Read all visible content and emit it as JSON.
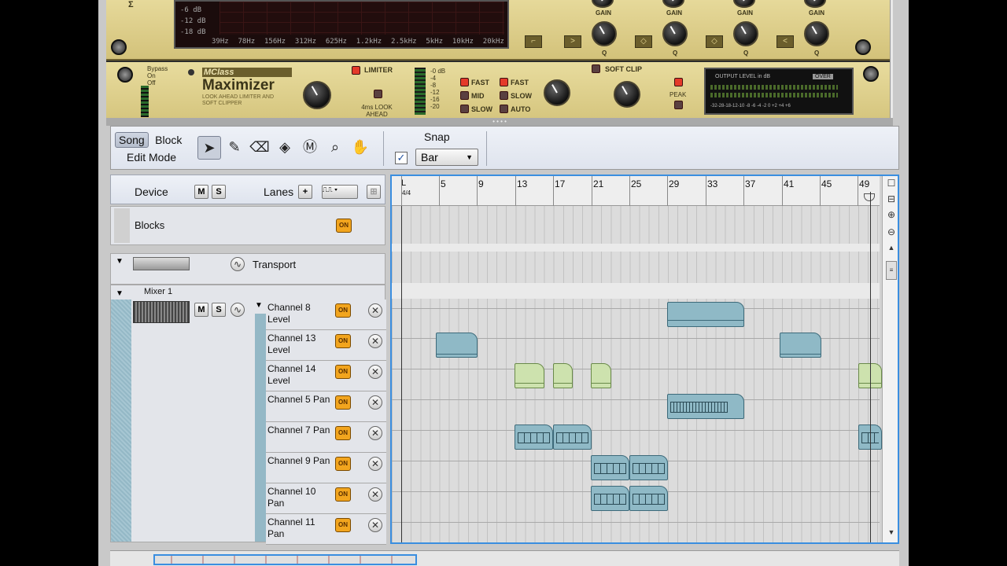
{
  "eq": {
    "db_labels": [
      "-6 dB",
      "-12 dB",
      "-18 dB"
    ],
    "freq_labels": [
      "39Hz",
      "78Hz",
      "156Hz",
      "312Hz",
      "625Hz",
      "1.2kHz",
      "2.5kHz",
      "5kHz",
      "10kHz",
      "20kHz"
    ],
    "gain_label": "GAIN",
    "q_label": "Q",
    "sigma": "Σ"
  },
  "maximizer": {
    "bypass": [
      "Bypass",
      "On",
      "Off"
    ],
    "brand": "MClass",
    "title": "Maximizer",
    "subtitle": "LOOK AHEAD LIMITER AND SOFT CLIPPER",
    "limiter_label": "LIMITER",
    "lookahead_label": "4ms LOOK AHEAD",
    "meter_scale": [
      "-0 dB",
      "-4",
      "-8",
      "-12",
      "-16",
      "-20"
    ],
    "attack": [
      "FAST",
      "MID",
      "SLOW"
    ],
    "release": [
      "FAST",
      "SLOW",
      "AUTO"
    ],
    "softclip_label": "SOFT CLIP",
    "peak_label": "PEAK",
    "output_label": "OUTPUT LEVEL in dB",
    "over_label": "OVER",
    "output_scale": "-32-28-18-12-10 -8 -6 -4 -2  0 +2 +4 +6"
  },
  "toolbar": {
    "song_label": "Song",
    "block_label": "Block",
    "edit_mode_label": "Edit Mode",
    "snap_label": "Snap",
    "snap_value": "Bar",
    "snap_checked": "✓"
  },
  "track_header": {
    "device_label": "Device",
    "mute_label": "M",
    "solo_label": "S",
    "lanes_label": "Lanes",
    "add_label": "+"
  },
  "tracks": {
    "blocks_label": "Blocks",
    "transport_label": "Transport",
    "mixer_label": "Mixer 1",
    "on_label": "ON"
  },
  "lanes": [
    {
      "label": "Channel 8 Level"
    },
    {
      "label": "Channel 13 Level"
    },
    {
      "label": "Channel 14 Level"
    },
    {
      "label": "Channel 5 Pan"
    },
    {
      "label": "Channel 7 Pan"
    },
    {
      "label": "Channel 9 Pan"
    },
    {
      "label": "Channel 10 Pan"
    },
    {
      "label": "Channel 11 Pan"
    }
  ],
  "ruler": {
    "loop_marker": "L",
    "time_sig": "4/4",
    "bars": [
      "5",
      "9",
      "13",
      "17",
      "21",
      "25",
      "29",
      "33",
      "37",
      "41",
      "45",
      "49"
    ]
  },
  "colors": {
    "clip_blue": "#8fb9c6",
    "clip_green": "#cde2ae",
    "on_orange": "#f2a51e",
    "selection_border": "#3a8ee0"
  }
}
